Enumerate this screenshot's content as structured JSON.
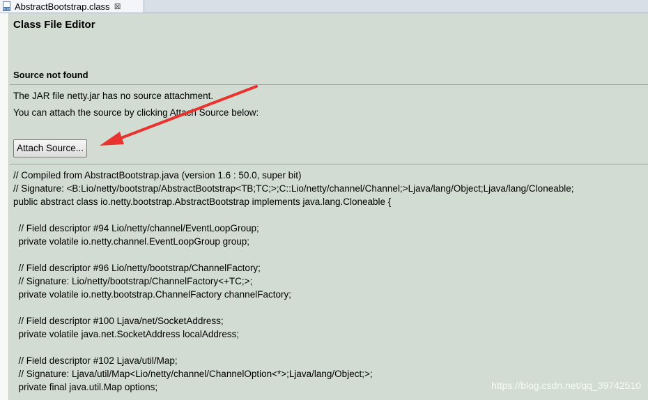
{
  "tab": {
    "label": "AbstractBootstrap.class",
    "close": "⊠"
  },
  "editor": {
    "title": "Class File Editor",
    "section_title": "Source not found",
    "message1": "The JAR file netty.jar has no source attachment.",
    "message2": "You can attach the source by clicking Attach Source below:",
    "attach_button": "Attach Source..."
  },
  "code_lines": [
    "// Compiled from AbstractBootstrap.java (version 1.6 : 50.0, super bit)",
    "// Signature: <B:Lio/netty/bootstrap/AbstractBootstrap<TB;TC;>;C::Lio/netty/channel/Channel;>Ljava/lang/Object;Ljava/lang/Cloneable;",
    "public abstract class io.netty.bootstrap.AbstractBootstrap implements java.lang.Cloneable {",
    "",
    "  // Field descriptor #94 Lio/netty/channel/EventLoopGroup;",
    "  private volatile io.netty.channel.EventLoopGroup group;",
    "",
    "  // Field descriptor #96 Lio/netty/bootstrap/ChannelFactory;",
    "  // Signature: Lio/netty/bootstrap/ChannelFactory<+TC;>;",
    "  private volatile io.netty.bootstrap.ChannelFactory channelFactory;",
    "",
    "  // Field descriptor #100 Ljava/net/SocketAddress;",
    "  private volatile java.net.SocketAddress localAddress;",
    "",
    "  // Field descriptor #102 Ljava/util/Map;",
    "  // Signature: Ljava/util/Map<Lio/netty/channel/ChannelOption<*>;Ljava/lang/Object;>;",
    "  private final java.util.Map options;"
  ],
  "watermark": "https://blog.csdn.net/qq_39742510",
  "colors": {
    "editor_background": "#d2dcd2",
    "separator": "#8f9fb8",
    "annotation_arrow": "#e8332e"
  },
  "icons": {
    "tab_icon": "class-file-icon",
    "annotation": "red-arrow-icon"
  }
}
